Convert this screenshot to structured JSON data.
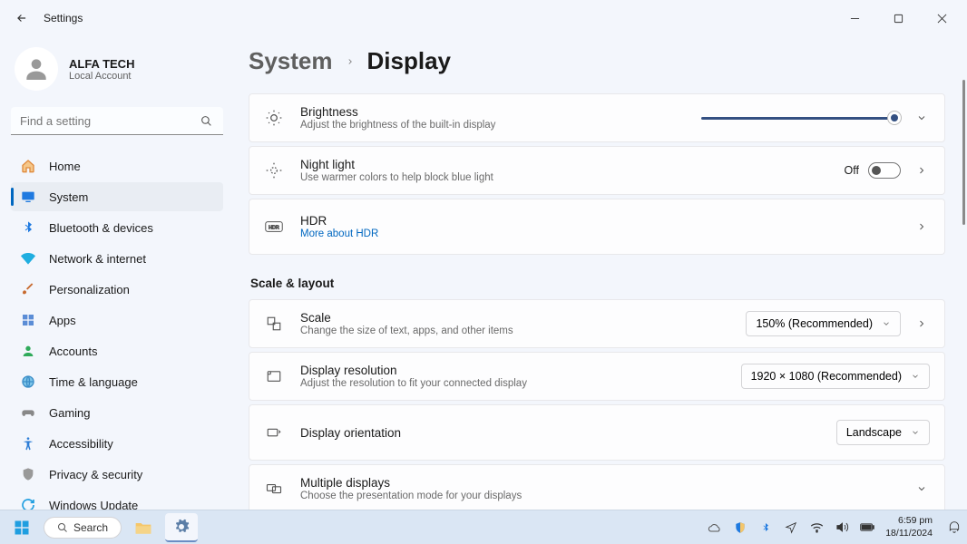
{
  "window": {
    "title": "Settings"
  },
  "profile": {
    "name": "ALFA TECH",
    "account_type": "Local Account"
  },
  "search": {
    "placeholder": "Find a setting"
  },
  "nav": {
    "items": [
      {
        "label": "Home",
        "icon": "home"
      },
      {
        "label": "System",
        "icon": "system"
      },
      {
        "label": "Bluetooth & devices",
        "icon": "bluetooth"
      },
      {
        "label": "Network & internet",
        "icon": "wifi"
      },
      {
        "label": "Personalization",
        "icon": "brush"
      },
      {
        "label": "Apps",
        "icon": "apps"
      },
      {
        "label": "Accounts",
        "icon": "person"
      },
      {
        "label": "Time & language",
        "icon": "globe"
      },
      {
        "label": "Gaming",
        "icon": "gamepad"
      },
      {
        "label": "Accessibility",
        "icon": "access"
      },
      {
        "label": "Privacy & security",
        "icon": "shield"
      },
      {
        "label": "Windows Update",
        "icon": "update"
      }
    ]
  },
  "breadcrumb": {
    "parent": "System",
    "current": "Display"
  },
  "cards": {
    "brightness": {
      "title": "Brightness",
      "sub": "Adjust the brightness of the built-in display",
      "value_percent": 100
    },
    "nightlight": {
      "title": "Night light",
      "sub": "Use warmer colors to help block blue light",
      "toggle_state": "Off"
    },
    "hdr": {
      "title": "HDR",
      "link": "More about HDR"
    },
    "scale": {
      "title": "Scale",
      "sub": "Change the size of text, apps, and other items",
      "value": "150% (Recommended)"
    },
    "resolution": {
      "title": "Display resolution",
      "sub": "Adjust the resolution to fit your connected display",
      "value": "1920 × 1080 (Recommended)"
    },
    "orientation": {
      "title": "Display orientation",
      "value": "Landscape"
    },
    "multiple": {
      "title": "Multiple displays",
      "sub": "Choose the presentation mode for your displays"
    }
  },
  "section": {
    "scale_layout": "Scale & layout"
  },
  "taskbar": {
    "search": "Search",
    "time": "6:59 pm",
    "date": "18/11/2024"
  }
}
